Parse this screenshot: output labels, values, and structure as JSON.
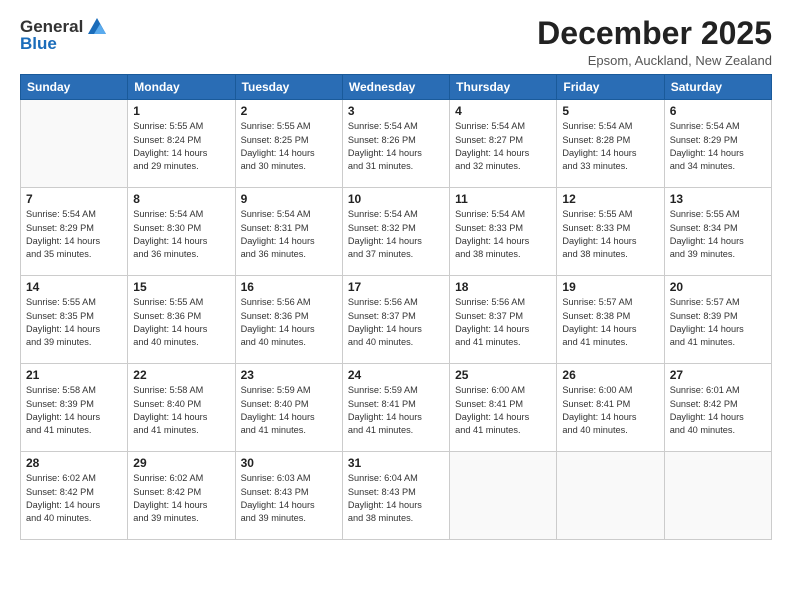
{
  "logo": {
    "general": "General",
    "blue": "Blue"
  },
  "title": "December 2025",
  "location": "Epsom, Auckland, New Zealand",
  "days_of_week": [
    "Sunday",
    "Monday",
    "Tuesday",
    "Wednesday",
    "Thursday",
    "Friday",
    "Saturday"
  ],
  "weeks": [
    [
      {
        "day": "",
        "info": ""
      },
      {
        "day": "1",
        "info": "Sunrise: 5:55 AM\nSunset: 8:24 PM\nDaylight: 14 hours\nand 29 minutes."
      },
      {
        "day": "2",
        "info": "Sunrise: 5:55 AM\nSunset: 8:25 PM\nDaylight: 14 hours\nand 30 minutes."
      },
      {
        "day": "3",
        "info": "Sunrise: 5:54 AM\nSunset: 8:26 PM\nDaylight: 14 hours\nand 31 minutes."
      },
      {
        "day": "4",
        "info": "Sunrise: 5:54 AM\nSunset: 8:27 PM\nDaylight: 14 hours\nand 32 minutes."
      },
      {
        "day": "5",
        "info": "Sunrise: 5:54 AM\nSunset: 8:28 PM\nDaylight: 14 hours\nand 33 minutes."
      },
      {
        "day": "6",
        "info": "Sunrise: 5:54 AM\nSunset: 8:29 PM\nDaylight: 14 hours\nand 34 minutes."
      }
    ],
    [
      {
        "day": "7",
        "info": "Sunrise: 5:54 AM\nSunset: 8:29 PM\nDaylight: 14 hours\nand 35 minutes."
      },
      {
        "day": "8",
        "info": "Sunrise: 5:54 AM\nSunset: 8:30 PM\nDaylight: 14 hours\nand 36 minutes."
      },
      {
        "day": "9",
        "info": "Sunrise: 5:54 AM\nSunset: 8:31 PM\nDaylight: 14 hours\nand 36 minutes."
      },
      {
        "day": "10",
        "info": "Sunrise: 5:54 AM\nSunset: 8:32 PM\nDaylight: 14 hours\nand 37 minutes."
      },
      {
        "day": "11",
        "info": "Sunrise: 5:54 AM\nSunset: 8:33 PM\nDaylight: 14 hours\nand 38 minutes."
      },
      {
        "day": "12",
        "info": "Sunrise: 5:55 AM\nSunset: 8:33 PM\nDaylight: 14 hours\nand 38 minutes."
      },
      {
        "day": "13",
        "info": "Sunrise: 5:55 AM\nSunset: 8:34 PM\nDaylight: 14 hours\nand 39 minutes."
      }
    ],
    [
      {
        "day": "14",
        "info": "Sunrise: 5:55 AM\nSunset: 8:35 PM\nDaylight: 14 hours\nand 39 minutes."
      },
      {
        "day": "15",
        "info": "Sunrise: 5:55 AM\nSunset: 8:36 PM\nDaylight: 14 hours\nand 40 minutes."
      },
      {
        "day": "16",
        "info": "Sunrise: 5:56 AM\nSunset: 8:36 PM\nDaylight: 14 hours\nand 40 minutes."
      },
      {
        "day": "17",
        "info": "Sunrise: 5:56 AM\nSunset: 8:37 PM\nDaylight: 14 hours\nand 40 minutes."
      },
      {
        "day": "18",
        "info": "Sunrise: 5:56 AM\nSunset: 8:37 PM\nDaylight: 14 hours\nand 41 minutes."
      },
      {
        "day": "19",
        "info": "Sunrise: 5:57 AM\nSunset: 8:38 PM\nDaylight: 14 hours\nand 41 minutes."
      },
      {
        "day": "20",
        "info": "Sunrise: 5:57 AM\nSunset: 8:39 PM\nDaylight: 14 hours\nand 41 minutes."
      }
    ],
    [
      {
        "day": "21",
        "info": "Sunrise: 5:58 AM\nSunset: 8:39 PM\nDaylight: 14 hours\nand 41 minutes."
      },
      {
        "day": "22",
        "info": "Sunrise: 5:58 AM\nSunset: 8:40 PM\nDaylight: 14 hours\nand 41 minutes."
      },
      {
        "day": "23",
        "info": "Sunrise: 5:59 AM\nSunset: 8:40 PM\nDaylight: 14 hours\nand 41 minutes."
      },
      {
        "day": "24",
        "info": "Sunrise: 5:59 AM\nSunset: 8:41 PM\nDaylight: 14 hours\nand 41 minutes."
      },
      {
        "day": "25",
        "info": "Sunrise: 6:00 AM\nSunset: 8:41 PM\nDaylight: 14 hours\nand 41 minutes."
      },
      {
        "day": "26",
        "info": "Sunrise: 6:00 AM\nSunset: 8:41 PM\nDaylight: 14 hours\nand 40 minutes."
      },
      {
        "day": "27",
        "info": "Sunrise: 6:01 AM\nSunset: 8:42 PM\nDaylight: 14 hours\nand 40 minutes."
      }
    ],
    [
      {
        "day": "28",
        "info": "Sunrise: 6:02 AM\nSunset: 8:42 PM\nDaylight: 14 hours\nand 40 minutes."
      },
      {
        "day": "29",
        "info": "Sunrise: 6:02 AM\nSunset: 8:42 PM\nDaylight: 14 hours\nand 39 minutes."
      },
      {
        "day": "30",
        "info": "Sunrise: 6:03 AM\nSunset: 8:43 PM\nDaylight: 14 hours\nand 39 minutes."
      },
      {
        "day": "31",
        "info": "Sunrise: 6:04 AM\nSunset: 8:43 PM\nDaylight: 14 hours\nand 38 minutes."
      },
      {
        "day": "",
        "info": ""
      },
      {
        "day": "",
        "info": ""
      },
      {
        "day": "",
        "info": ""
      }
    ]
  ]
}
